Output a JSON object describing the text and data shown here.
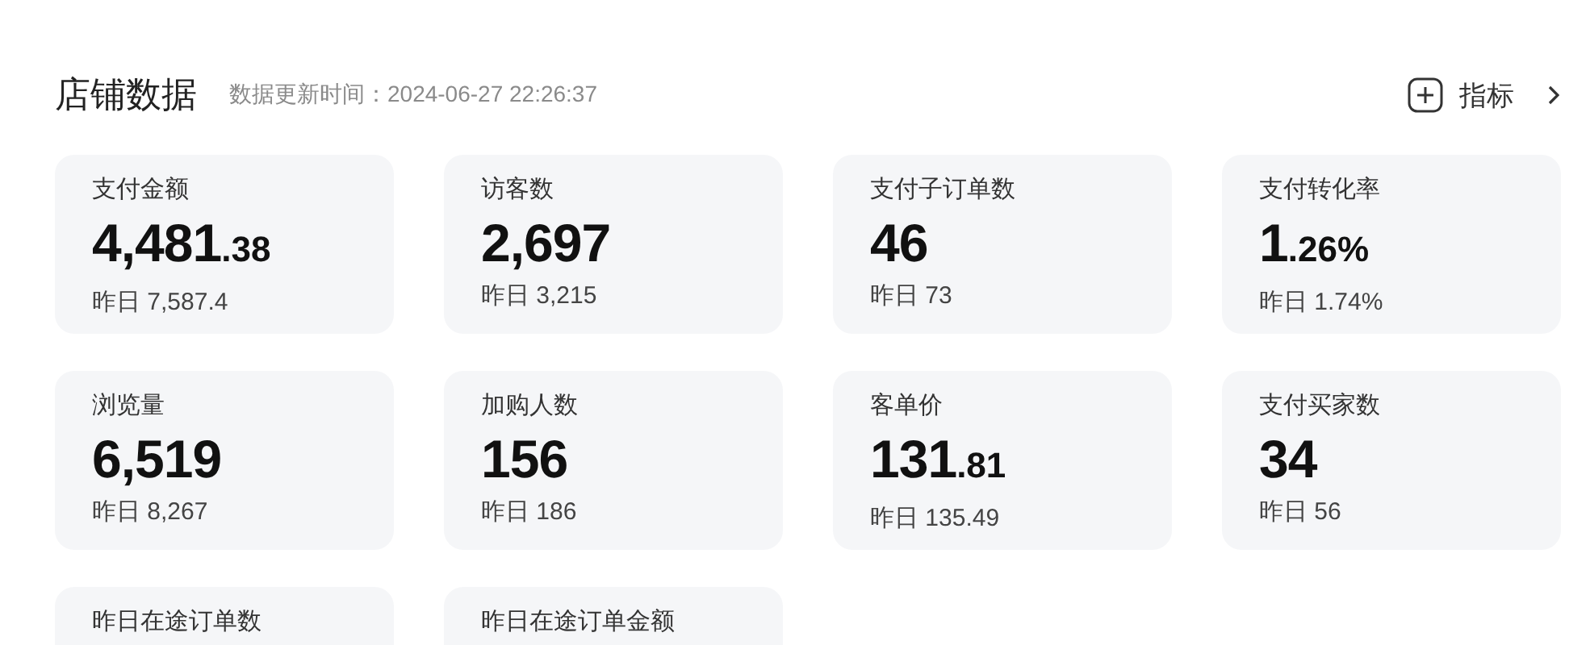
{
  "header": {
    "title": "店铺数据",
    "update_time": "数据更新时间：2024-06-27 22:26:37",
    "action": {
      "label": "指标"
    }
  },
  "metrics": [
    {
      "label": "支付金额",
      "value": "4,481",
      "decimal": ".38",
      "yesterday_label": "昨日",
      "yesterday": "7,587.4"
    },
    {
      "label": "访客数",
      "value": "2,697",
      "yesterday_label": "昨日",
      "yesterday": "3,215"
    },
    {
      "label": "支付子订单数",
      "value": "46",
      "yesterday_label": "昨日",
      "yesterday": "73"
    },
    {
      "label": "支付转化率",
      "value": "1",
      "decimal": ".26%",
      "yesterday_label": "昨日",
      "yesterday": "1.74%"
    },
    {
      "label": "浏览量",
      "value": "6,519",
      "yesterday_label": "昨日",
      "yesterday": "8,267"
    },
    {
      "label": "加购人数",
      "value": "156",
      "yesterday_label": "昨日",
      "yesterday": "186"
    },
    {
      "label": "客单价",
      "value": "131",
      "decimal": ".81",
      "yesterday_label": "昨日",
      "yesterday": "135.49"
    },
    {
      "label": "支付买家数",
      "value": "34",
      "yesterday_label": "昨日",
      "yesterday": "56"
    },
    {
      "label": "昨日在途订单数"
    },
    {
      "label": "昨日在途订单金额"
    }
  ]
}
